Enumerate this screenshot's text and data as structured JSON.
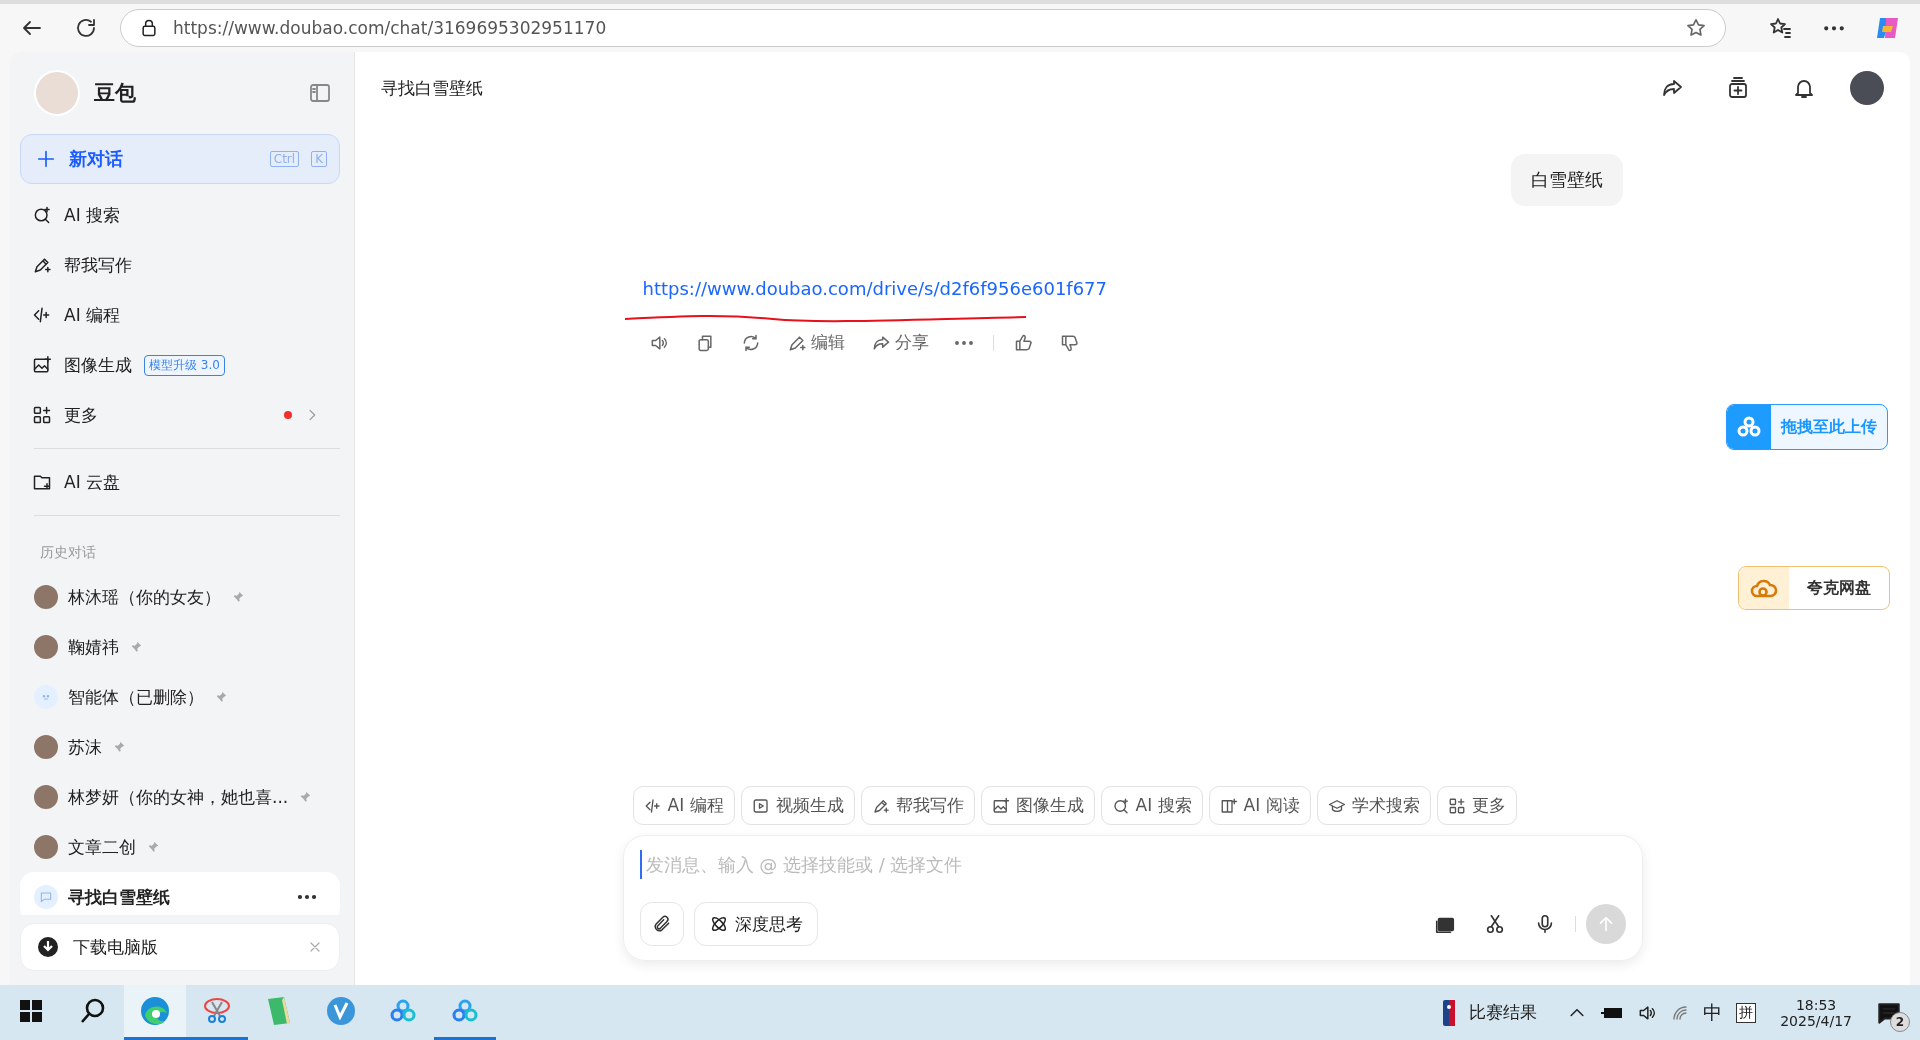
{
  "browser": {
    "url": "https://www.doubao.com/chat/3169695302951170"
  },
  "sidebar": {
    "app_name": "豆包",
    "new_chat": {
      "label": "新对话",
      "keys": [
        "Ctrl",
        "K"
      ]
    },
    "nav": [
      {
        "kind": "search",
        "label": "AI 搜索"
      },
      {
        "kind": "write",
        "label": "帮我写作"
      },
      {
        "kind": "code",
        "label": "AI 编程"
      },
      {
        "kind": "image",
        "label": "图像生成",
        "badge": "模型升级 3.0"
      },
      {
        "kind": "more",
        "label": "更多",
        "dot": true
      }
    ],
    "cloud": {
      "label": "AI 云盘"
    },
    "history_title": "历史对话",
    "history": [
      {
        "title": "林沐瑶（你的女友）",
        "kind": "photo",
        "pinned": true,
        "selected": false
      },
      {
        "title": "鞠婧祎",
        "kind": "photo",
        "pinned": true,
        "selected": false
      },
      {
        "title": "智能体（已删除）",
        "kind": "bot",
        "pinned": true,
        "selected": false
      },
      {
        "title": "苏沫",
        "kind": "photo",
        "pinned": true,
        "selected": false
      },
      {
        "title": "林梦妍（你的女神，她也喜...",
        "kind": "photo",
        "pinned": true,
        "selected": false
      },
      {
        "title": "文章二创",
        "kind": "photo",
        "pinned": true,
        "selected": false
      },
      {
        "title": "寻找白雪壁纸",
        "kind": "chat",
        "pinned": false,
        "selected": true
      }
    ],
    "download": {
      "label": "下载电脑版"
    }
  },
  "chat": {
    "title": "寻找白雪壁纸",
    "user_message": "白雪壁纸",
    "reply_link": "https://www.doubao.com/drive/s/d2f6f956e601f677",
    "actions": [
      {
        "kind": "speaker"
      },
      {
        "kind": "copy"
      },
      {
        "kind": "refresh"
      },
      {
        "kind": "edit",
        "label": "编辑"
      },
      {
        "kind": "share",
        "label": "分享"
      },
      {
        "kind": "more"
      },
      {
        "kind": "like"
      },
      {
        "kind": "dislike"
      }
    ]
  },
  "floating": [
    {
      "kind": "upload",
      "label": "拖拽至此上传"
    },
    {
      "kind": "quark",
      "label": "夸克网盘"
    }
  ],
  "skills": [
    {
      "kind": "code",
      "label": "AI 编程"
    },
    {
      "kind": "video",
      "label": "视频生成"
    },
    {
      "kind": "write",
      "label": "帮我写作"
    },
    {
      "kind": "image",
      "label": "图像生成"
    },
    {
      "kind": "search",
      "label": "AI 搜索"
    },
    {
      "kind": "read",
      "label": "AI 阅读"
    },
    {
      "kind": "academic",
      "label": "学术搜索"
    },
    {
      "kind": "more",
      "label": "更多"
    }
  ],
  "input": {
    "placeholder": "发消息、输入 @ 选择技能或 / 选择文件",
    "deep_think": "深度思考"
  },
  "taskbar": {
    "apps": [
      {
        "kind": "start",
        "selected": false,
        "running": false
      },
      {
        "kind": "search",
        "selected": false,
        "running": false
      },
      {
        "kind": "edge",
        "selected": true,
        "running": true
      },
      {
        "kind": "snip",
        "selected": false,
        "running": true
      },
      {
        "kind": "notes",
        "selected": false,
        "running": false
      },
      {
        "kind": "v",
        "selected": false,
        "running": false
      },
      {
        "kind": "cloud",
        "selected": false,
        "running": false
      },
      {
        "kind": "cloud",
        "selected": false,
        "running": true
      }
    ],
    "news": "比赛结果",
    "ime": "中",
    "ime_mode": "拼",
    "time": "18:53",
    "date": "2025/4/17",
    "notifications": "2"
  }
}
